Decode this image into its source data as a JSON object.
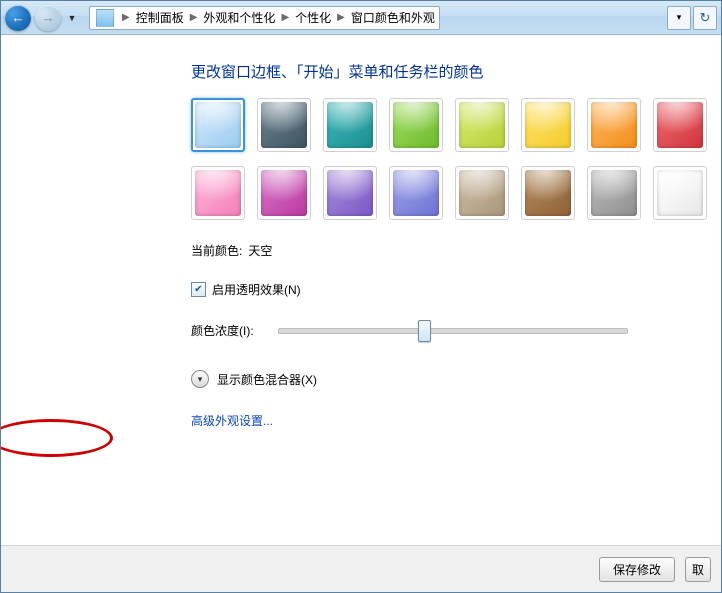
{
  "breadcrumb": {
    "items": [
      "控制面板",
      "外观和个性化",
      "个性化",
      "窗口颜色和外观"
    ]
  },
  "page": {
    "heading": "更改窗口边框、「开始」菜单和任务栏的颜色",
    "current_color_label": "当前颜色:",
    "current_color_value": "天空",
    "transparency_label": "启用透明效果(N)",
    "transparency_checked": true,
    "intensity_label": "颜色浓度(I):",
    "intensity_value": 0.4,
    "mixer_label": "显示颜色混合器(X)",
    "advanced_link": "高级外观设置..."
  },
  "swatches": {
    "row1": [
      {
        "name": "sky",
        "c1": "#cfe8fb",
        "c2": "#9cccef",
        "selected": true
      },
      {
        "name": "graphite",
        "c1": "#6e8593",
        "c2": "#3e545f"
      },
      {
        "name": "teal",
        "c1": "#3fb9bb",
        "c2": "#1c8e90"
      },
      {
        "name": "leaf",
        "c1": "#9fdd5f",
        "c2": "#6fbb2e"
      },
      {
        "name": "lime",
        "c1": "#d5e86c",
        "c2": "#b9d23c"
      },
      {
        "name": "sun",
        "c1": "#ffe26a",
        "c2": "#f3cc2e"
      },
      {
        "name": "pumpkin",
        "c1": "#ffb65e",
        "c2": "#f28f1c"
      },
      {
        "name": "ruby",
        "c1": "#ef6a70",
        "c2": "#d2353d"
      }
    ],
    "row2": [
      {
        "name": "pink",
        "c1": "#ffb7d9",
        "c2": "#f37fb8"
      },
      {
        "name": "fuchsia",
        "c1": "#d975c7",
        "c2": "#b93aa1"
      },
      {
        "name": "violet",
        "c1": "#a98fde",
        "c2": "#7a58c6"
      },
      {
        "name": "lavender",
        "c1": "#9fa4e9",
        "c2": "#6d73d1"
      },
      {
        "name": "taupe",
        "c1": "#cdbfa8",
        "c2": "#a99678"
      },
      {
        "name": "chocolate",
        "c1": "#b68b60",
        "c2": "#8e6236"
      },
      {
        "name": "slate",
        "c1": "#bdbdbd",
        "c2": "#8e8e8e"
      },
      {
        "name": "frost",
        "c1": "#ffffff",
        "c2": "#e8e8e8"
      }
    ]
  },
  "footer": {
    "save": "保存修改",
    "cancel": "取"
  }
}
